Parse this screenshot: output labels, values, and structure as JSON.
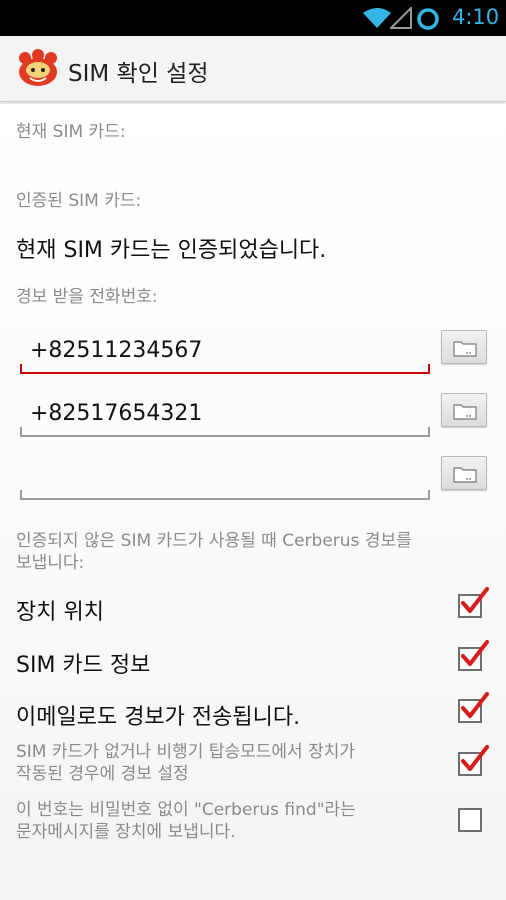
{
  "status_bar": {
    "time": "4:10",
    "icons": [
      "wifi-icon",
      "signal-icon",
      "sync-icon"
    ]
  },
  "action_bar": {
    "title": "SIM 확인 설정",
    "logo_icon": "cerberus-logo-icon"
  },
  "sections": {
    "current_sim_label": "현재 SIM 카드:",
    "authorized_sim_label": "인증된 SIM 카드:",
    "sim_status": "현재 SIM 카드는 인증되었습니다.",
    "alert_phone_label": "경보 받을 전화번호:"
  },
  "phone_numbers": [
    {
      "value": "+82511234567"
    },
    {
      "value": "+82517654321"
    },
    {
      "value": ""
    }
  ],
  "alert_description": [
    "인증되지 않은 SIM 카드가 사용될 때 Cerberus 경보를",
    "보냅니다:"
  ],
  "options": [
    {
      "label": "장치 위치",
      "checked": true
    },
    {
      "label": "SIM 카드 정보",
      "checked": true
    },
    {
      "label": "이메일로도 경보가 전송됩니다.",
      "checked": true
    },
    {
      "label_lines": [
        "SIM 카드가 없거나 비행기 탑승모드에서 장치가",
        "작동된 경우에 경보 설정"
      ],
      "checked": true
    },
    {
      "label_lines": [
        "이 번호는 비밀번호 없이 \"Cerberus find\"라는",
        "문자메시지를 장치에 보냅니다."
      ],
      "checked": false
    }
  ],
  "colors": {
    "accent_blue": "#33b5e5",
    "active_underline": "#cc0000",
    "check_red": "#d81b1b"
  }
}
